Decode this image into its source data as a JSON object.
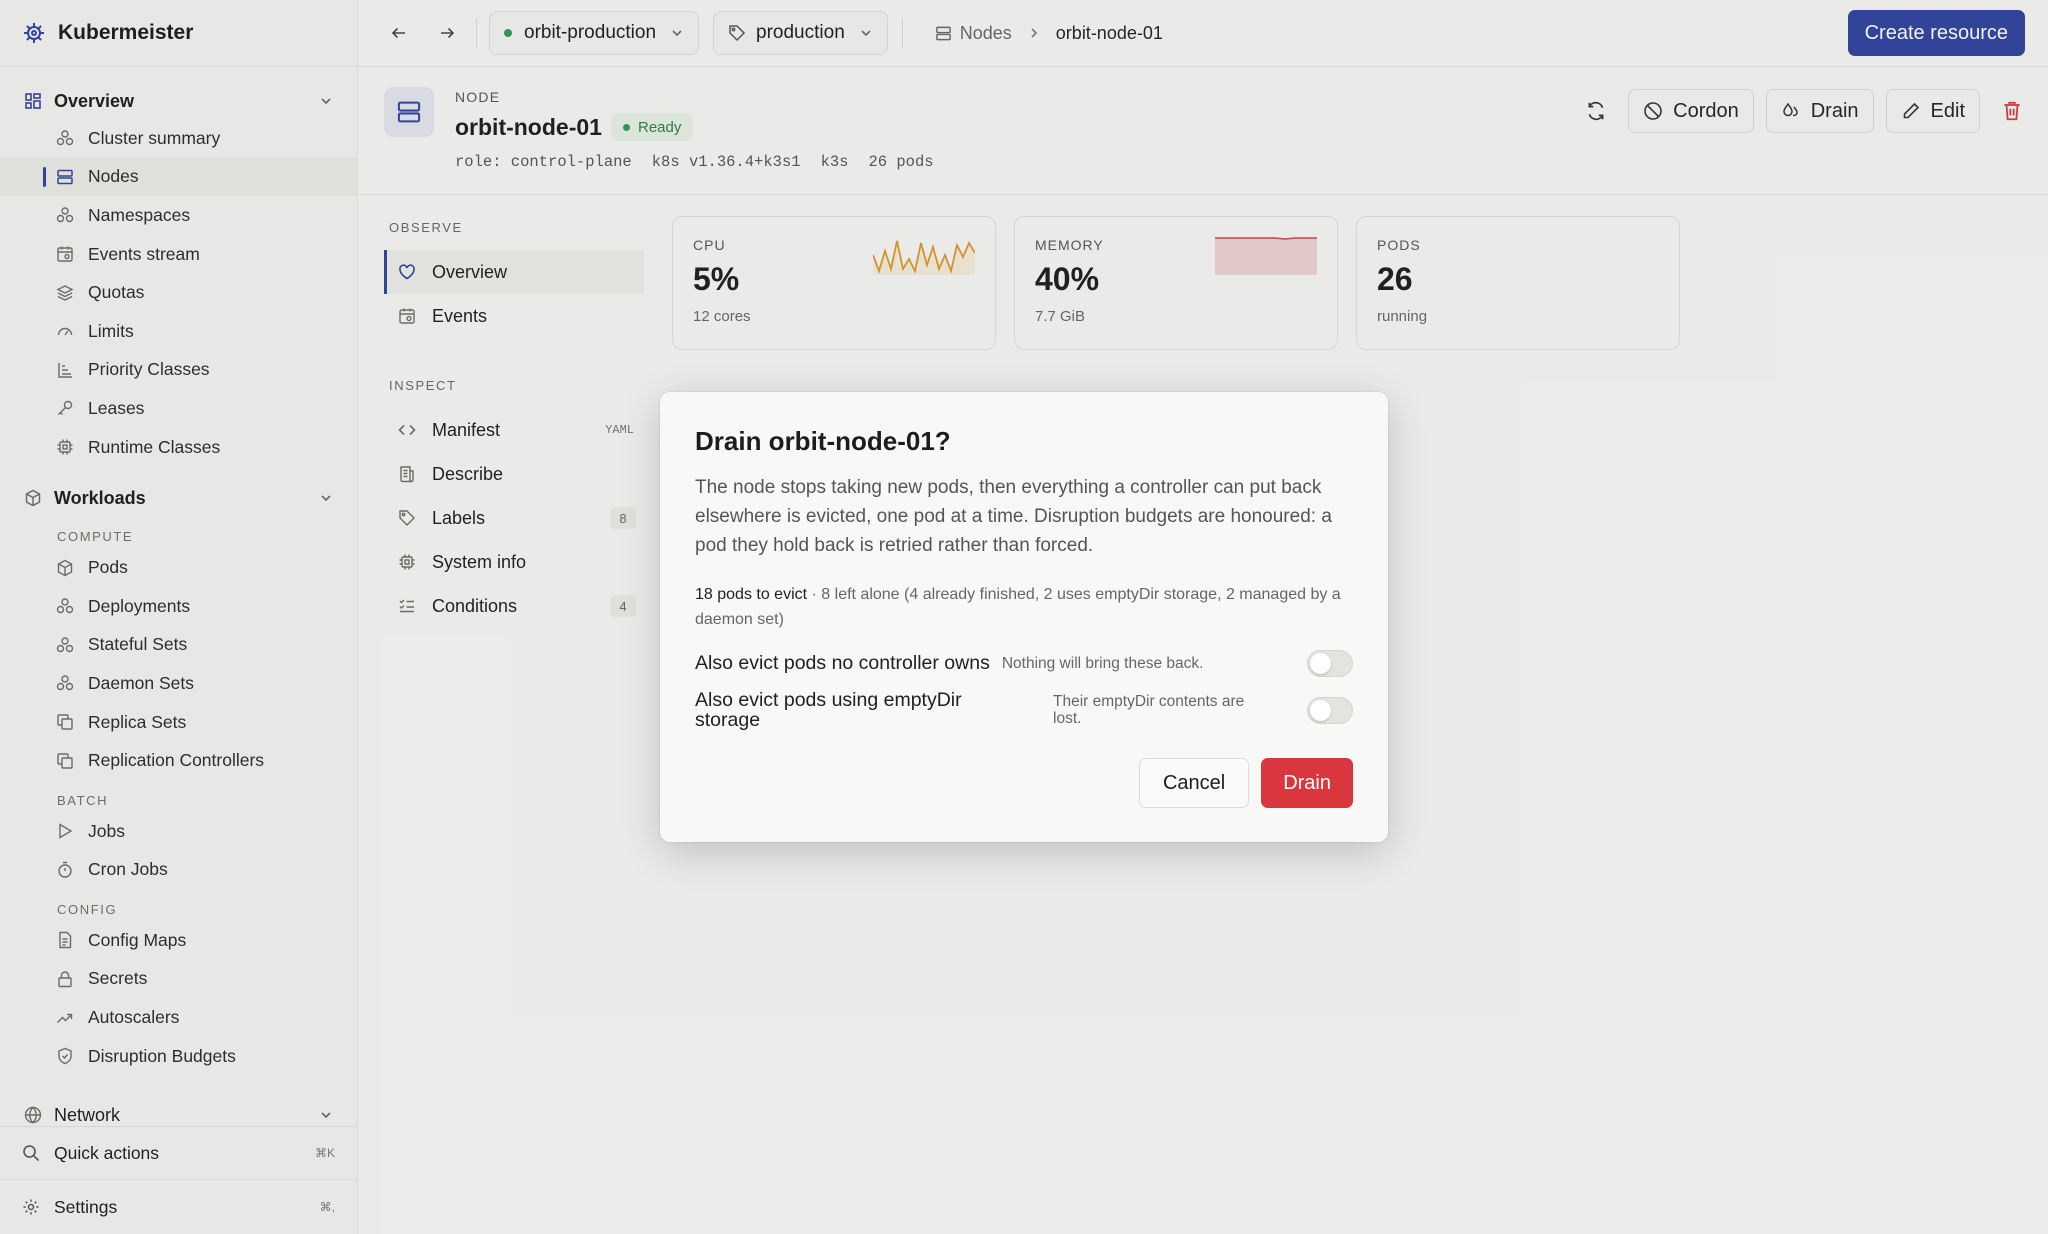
{
  "app": {
    "title": "Kubermeister"
  },
  "sidebar": {
    "overview": {
      "label": "Overview",
      "items": [
        {
          "label": "Cluster summary",
          "icon": "cluster-icon"
        },
        {
          "label": "Nodes",
          "icon": "server-icon",
          "active": true
        },
        {
          "label": "Namespaces",
          "icon": "namespaces-icon"
        },
        {
          "label": "Events stream",
          "icon": "calendar-icon"
        },
        {
          "label": "Quotas",
          "icon": "layers-icon"
        },
        {
          "label": "Limits",
          "icon": "gauge-icon"
        },
        {
          "label": "Priority Classes",
          "icon": "priority-icon"
        },
        {
          "label": "Leases",
          "icon": "key-icon"
        },
        {
          "label": "Runtime Classes",
          "icon": "chip-icon"
        }
      ]
    },
    "workloads": {
      "label": "Workloads",
      "compute_label": "COMPUTE",
      "compute": [
        "Pods",
        "Deployments",
        "Stateful Sets",
        "Daemon Sets",
        "Replica Sets",
        "Replication Controllers"
      ],
      "batch_label": "BATCH",
      "batch": [
        "Jobs",
        "Cron Jobs"
      ],
      "config_label": "CONFIG",
      "config": [
        "Config Maps",
        "Secrets",
        "Autoscalers",
        "Disruption Budgets"
      ]
    },
    "network": {
      "label": "Network"
    },
    "quick_actions": {
      "label": "Quick actions",
      "shortcut": "⌘K"
    },
    "settings": {
      "label": "Settings",
      "shortcut": "⌘,"
    }
  },
  "topbar": {
    "cluster": "orbit-production",
    "namespace": "production",
    "breadcrumb": {
      "parent": "Nodes",
      "current": "orbit-node-01"
    },
    "create_label": "Create resource"
  },
  "node": {
    "kind": "NODE",
    "name": "orbit-node-01",
    "status": "Ready",
    "meta": [
      "role: control-plane",
      "k8s v1.36.4+k3s1",
      "k3s",
      "26 pods"
    ],
    "actions": {
      "cordon": "Cordon",
      "drain": "Drain",
      "edit": "Edit"
    }
  },
  "subnav": {
    "observe_label": "OBSERVE",
    "observe": [
      {
        "label": "Overview",
        "active": true
      },
      {
        "label": "Events"
      }
    ],
    "inspect_label": "INSPECT",
    "inspect": [
      {
        "label": "Manifest",
        "tag": "YAML"
      },
      {
        "label": "Describe"
      },
      {
        "label": "Labels",
        "count": "8"
      },
      {
        "label": "System info"
      },
      {
        "label": "Conditions",
        "count": "4"
      }
    ]
  },
  "stats": {
    "cpu": {
      "label": "CPU",
      "value": "5%",
      "sub": "12 cores",
      "color": "#d99a2b"
    },
    "memory": {
      "label": "MEMORY",
      "value": "40%",
      "sub": "7.7 GiB",
      "color": "#c8474d"
    },
    "pods": {
      "label": "PODS",
      "value": "26",
      "sub": "running"
    }
  },
  "modal": {
    "title": "Drain orbit-node-01?",
    "body": "The node stops taking new pods, then everything a controller can put back elsewhere is evicted, one pod at a time. Disruption budgets are honoured: a pod they hold back is retried rather than forced.",
    "summary_strong": "18 pods to evict",
    "summary_rest": " · 8 left alone (4 already finished, 2 uses emptyDir storage, 2 managed by a daemon set)",
    "options": [
      {
        "label": "Also evict pods no controller owns",
        "note": "Nothing will bring these back.",
        "checked": false
      },
      {
        "label": "Also evict pods using emptyDir storage",
        "note": "Their emptyDir contents are lost.",
        "checked": false
      }
    ],
    "cancel_label": "Cancel",
    "confirm_label": "Drain",
    "confirm_color": "#d9363e"
  }
}
